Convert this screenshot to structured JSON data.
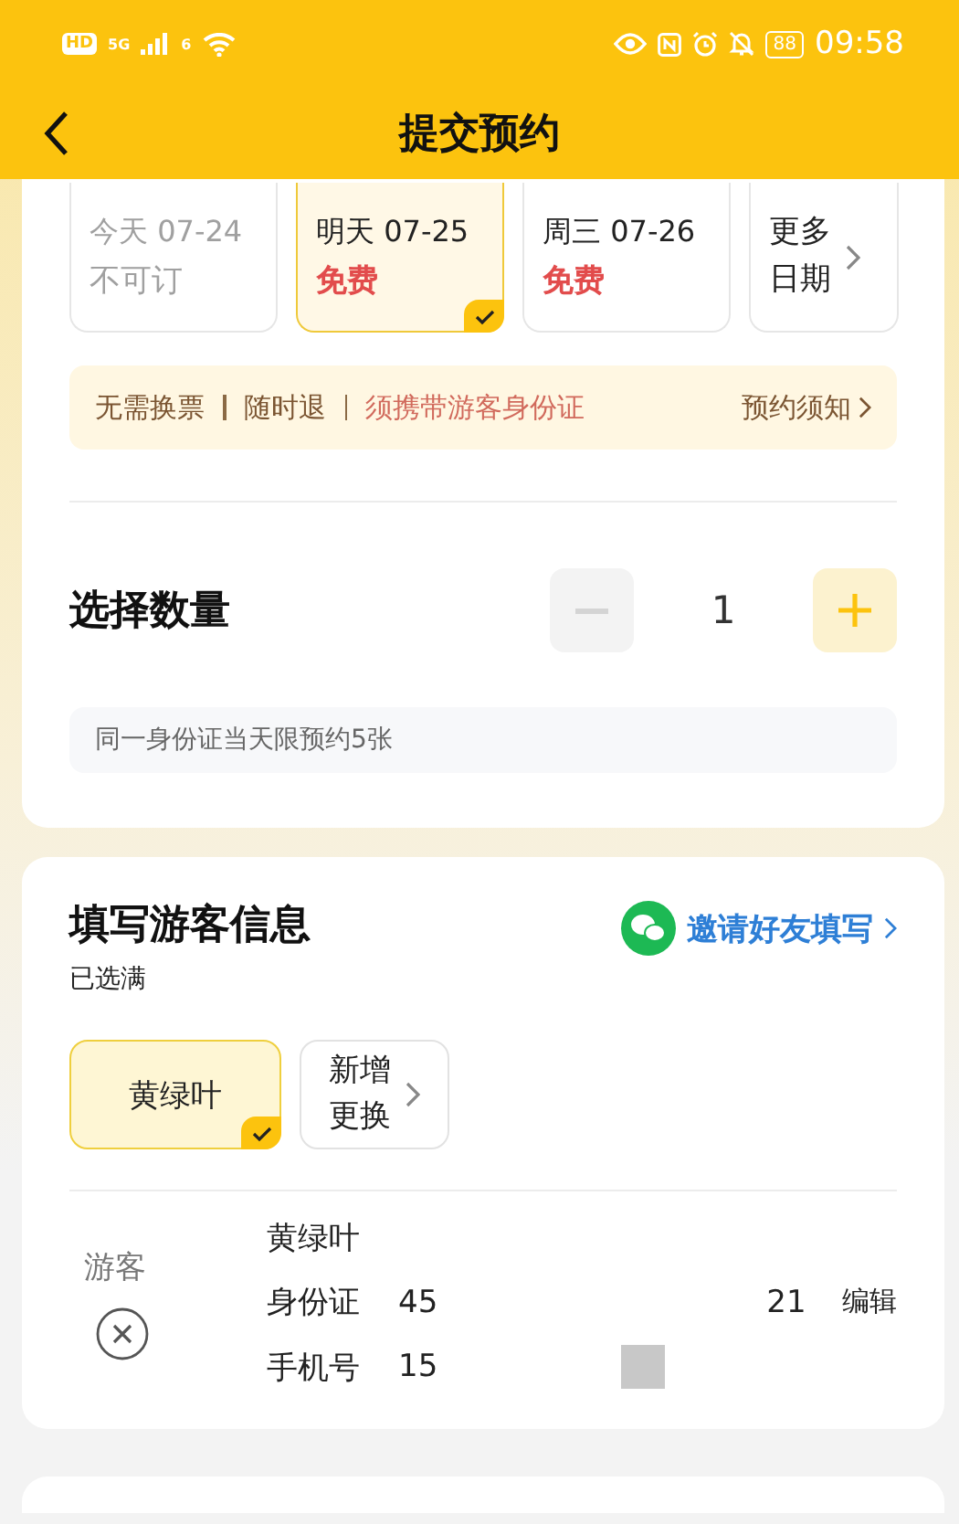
{
  "status_bar": {
    "hd": "HD",
    "network": "5G",
    "wifi_badge": "6",
    "battery": "88",
    "time": "09:58"
  },
  "header": {
    "title": "提交预约"
  },
  "dates": [
    {
      "day": "今天 07-24",
      "price": "不可订",
      "available": false,
      "selected": false
    },
    {
      "day": "明天 07-25",
      "price": "免费",
      "available": true,
      "selected": true
    },
    {
      "day": "周三 07-26",
      "price": "免费",
      "available": true,
      "selected": false
    }
  ],
  "more_dates": [
    "更多",
    "日期"
  ],
  "notice": {
    "items": [
      {
        "text": "无需换票",
        "highlight": false
      },
      {
        "text": "随时退",
        "highlight": false
      },
      {
        "text": "须携带游客身份证",
        "highlight": true
      }
    ],
    "link": "预约须知"
  },
  "quantity": {
    "title": "选择数量",
    "value": "1",
    "minus_disabled": true,
    "note": "同一身份证当天限预约5张"
  },
  "visitors": {
    "title": "填写游客信息",
    "subtitle": "已选满",
    "invite": "邀请好友填写",
    "chips": [
      {
        "name": "黄绿叶",
        "selected": true
      }
    ],
    "add": [
      "新增",
      "更换"
    ],
    "entry": {
      "role": "游客",
      "name": "黄绿叶",
      "id_label": "身份证",
      "id_start": "45",
      "id_end": "21",
      "phone_label": "手机号",
      "phone_start": "15",
      "edit": "编辑"
    }
  }
}
